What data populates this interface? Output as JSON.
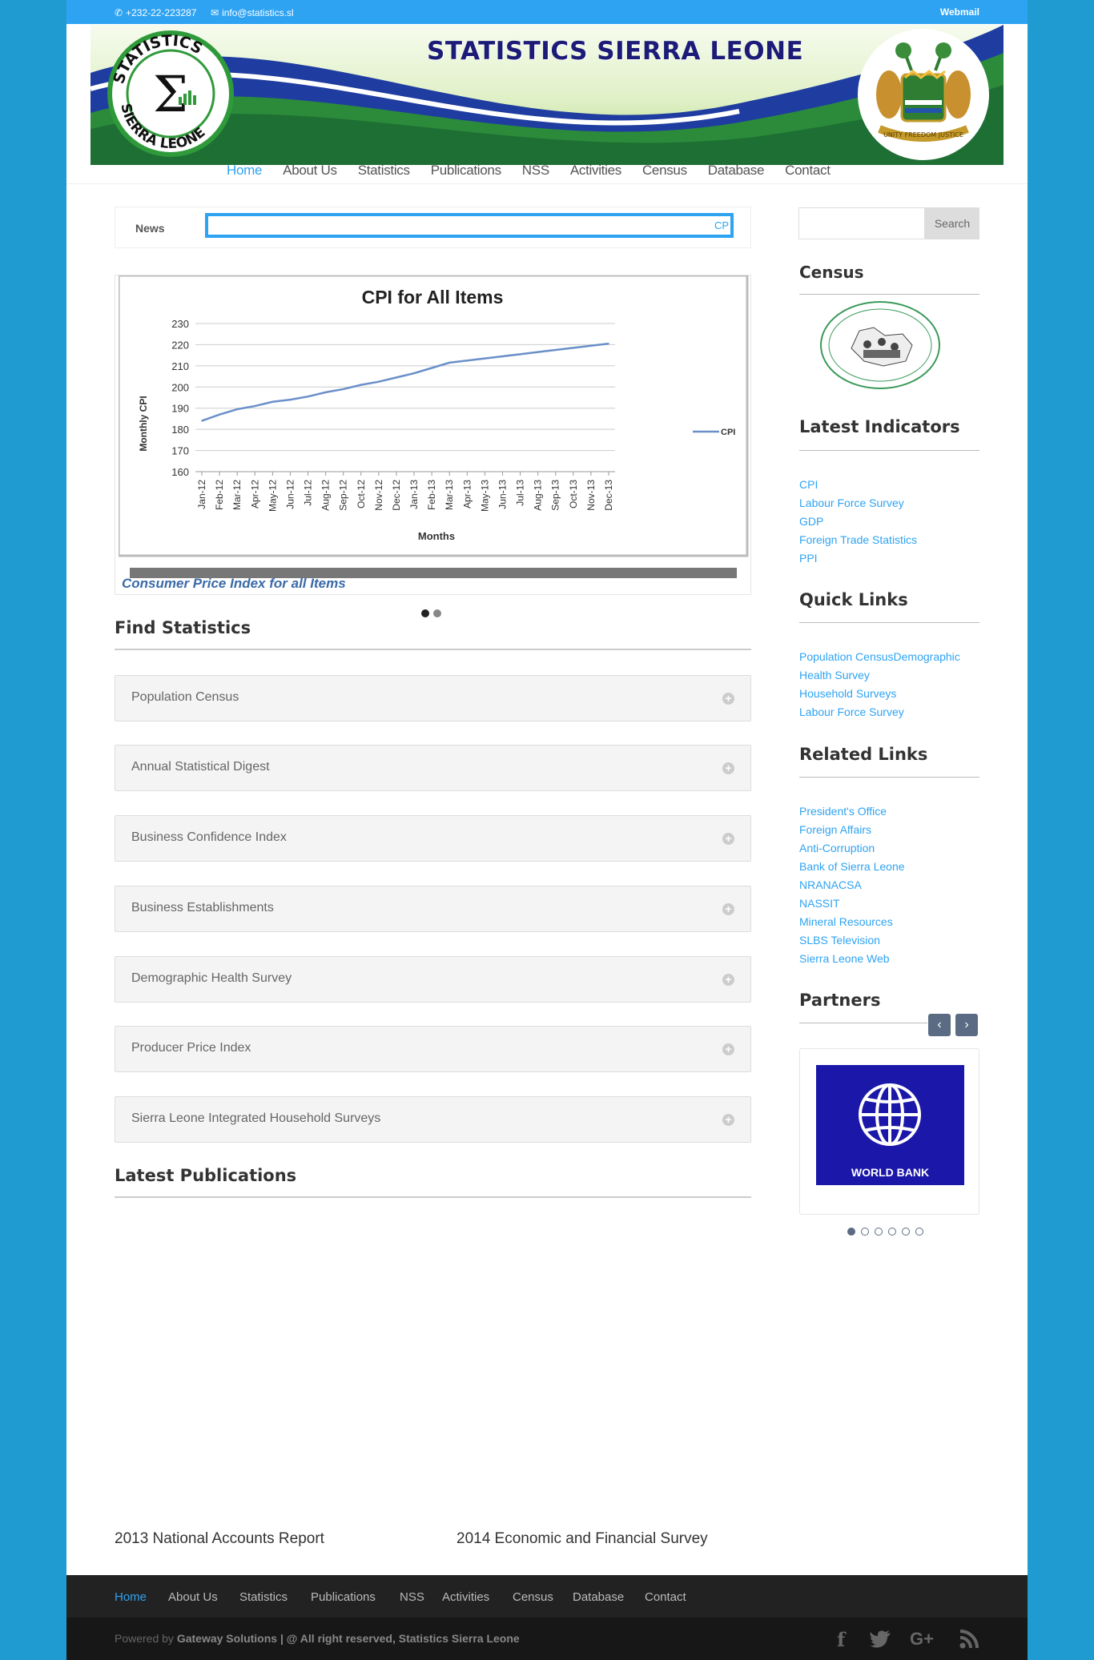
{
  "topbar": {
    "phone": "+232-22-223287",
    "email": "info@statistics.sl",
    "webmail": "Webmail"
  },
  "banner": {
    "title": "STATISTICS SIERRA LEONE",
    "logo_text_top": "STATISTICS",
    "logo_text_bottom": "SIERRA LEONE",
    "logo_symbol": "Σ"
  },
  "nav": {
    "items": [
      "Home",
      "About Us",
      "Statistics",
      "Publications",
      "NSS",
      "Activities",
      "Census",
      "Database",
      "Contact"
    ],
    "active": "Home"
  },
  "news": {
    "label": "News",
    "ticker_text": "CP"
  },
  "slider": {
    "caption": "Consumer Price Index for all Items",
    "slides": 2,
    "active_slide": 1
  },
  "chart_data": {
    "type": "line",
    "title": "CPI for All Items",
    "xlabel": "Months",
    "ylabel": "Monthly CPI",
    "ylim": [
      160,
      230
    ],
    "yticks": [
      160,
      170,
      180,
      190,
      200,
      210,
      220,
      230
    ],
    "categories": [
      "Jan-12",
      "Feb-12",
      "Mar-12",
      "Apr-12",
      "May-12",
      "Jun-12",
      "Jul-12",
      "Aug-12",
      "Sep-12",
      "Oct-12",
      "Nov-12",
      "Dec-12",
      "Jan-13",
      "Feb-13",
      "Mar-13",
      "Apr-13",
      "May-13",
      "Jun-13",
      "Jul-13",
      "Aug-13",
      "Sep-13",
      "Oct-13",
      "Nov-13",
      "Dec-13"
    ],
    "series": [
      {
        "name": "CPI",
        "color": "#6a8fc9",
        "values": [
          184,
          187,
          189.5,
          191,
          193,
          194,
          195.5,
          197.5,
          199,
          201,
          202.5,
          204.5,
          206.5,
          209,
          211.5,
          212.5,
          213.5,
          214.5,
          215.5,
          216.5,
          217.5,
          218.5,
          219.5,
          220.5
        ]
      }
    ],
    "legend": "right",
    "grid": true
  },
  "find_statistics": {
    "heading": "Find Statistics",
    "items": [
      "Population Census",
      "Annual Statistical Digest",
      "Business Confidence Index",
      "Business Establishments",
      "Demographic Health Survey",
      "Producer Price Index",
      "Sierra Leone Integrated Household Surveys"
    ]
  },
  "latest_publications": {
    "heading": "Latest Publications",
    "items": [
      "2013 National Accounts Report",
      "2014 Economic and Financial Survey"
    ]
  },
  "sidebar": {
    "search_button": "Search",
    "search_placeholder": "",
    "census_heading": "Census",
    "indicators_heading": "Latest Indicators",
    "indicators": [
      "CPI",
      "Labour Force Survey",
      "GDP",
      "Foreign Trade Statistics",
      "PPI"
    ],
    "quick_links_heading": "Quick Links",
    "quick_links": [
      "Population CensusDemographic",
      "Health Survey",
      "Household Surveys",
      "Labour Force Survey"
    ],
    "related_links_heading": "Related Links",
    "related_links": [
      "President's Office",
      "Foreign Affairs",
      "Anti-Corruption",
      "Bank of Sierra Leone",
      "NRANACSA",
      "NASSIT",
      "Mineral Resources",
      "SLBS Television",
      "Sierra Leone Web"
    ],
    "partners_heading": "Partners",
    "partner_label": "WORLD BANK",
    "partner_slides": 6,
    "partner_active": 1
  },
  "footer": {
    "nav": [
      "Home",
      "About Us",
      "Statistics",
      "Publications",
      "NSS",
      "Activities",
      "Census",
      "Database",
      "Contact"
    ],
    "active": "Home",
    "powered_prefix": "Powered by ",
    "powered_by": "Gateway Solutions",
    "rights": " | @ All right reserved, Statistics Sierra Leone"
  },
  "colors": {
    "accent": "#2ea3f2",
    "background": "#1f9bd1",
    "footer": "#222222"
  }
}
